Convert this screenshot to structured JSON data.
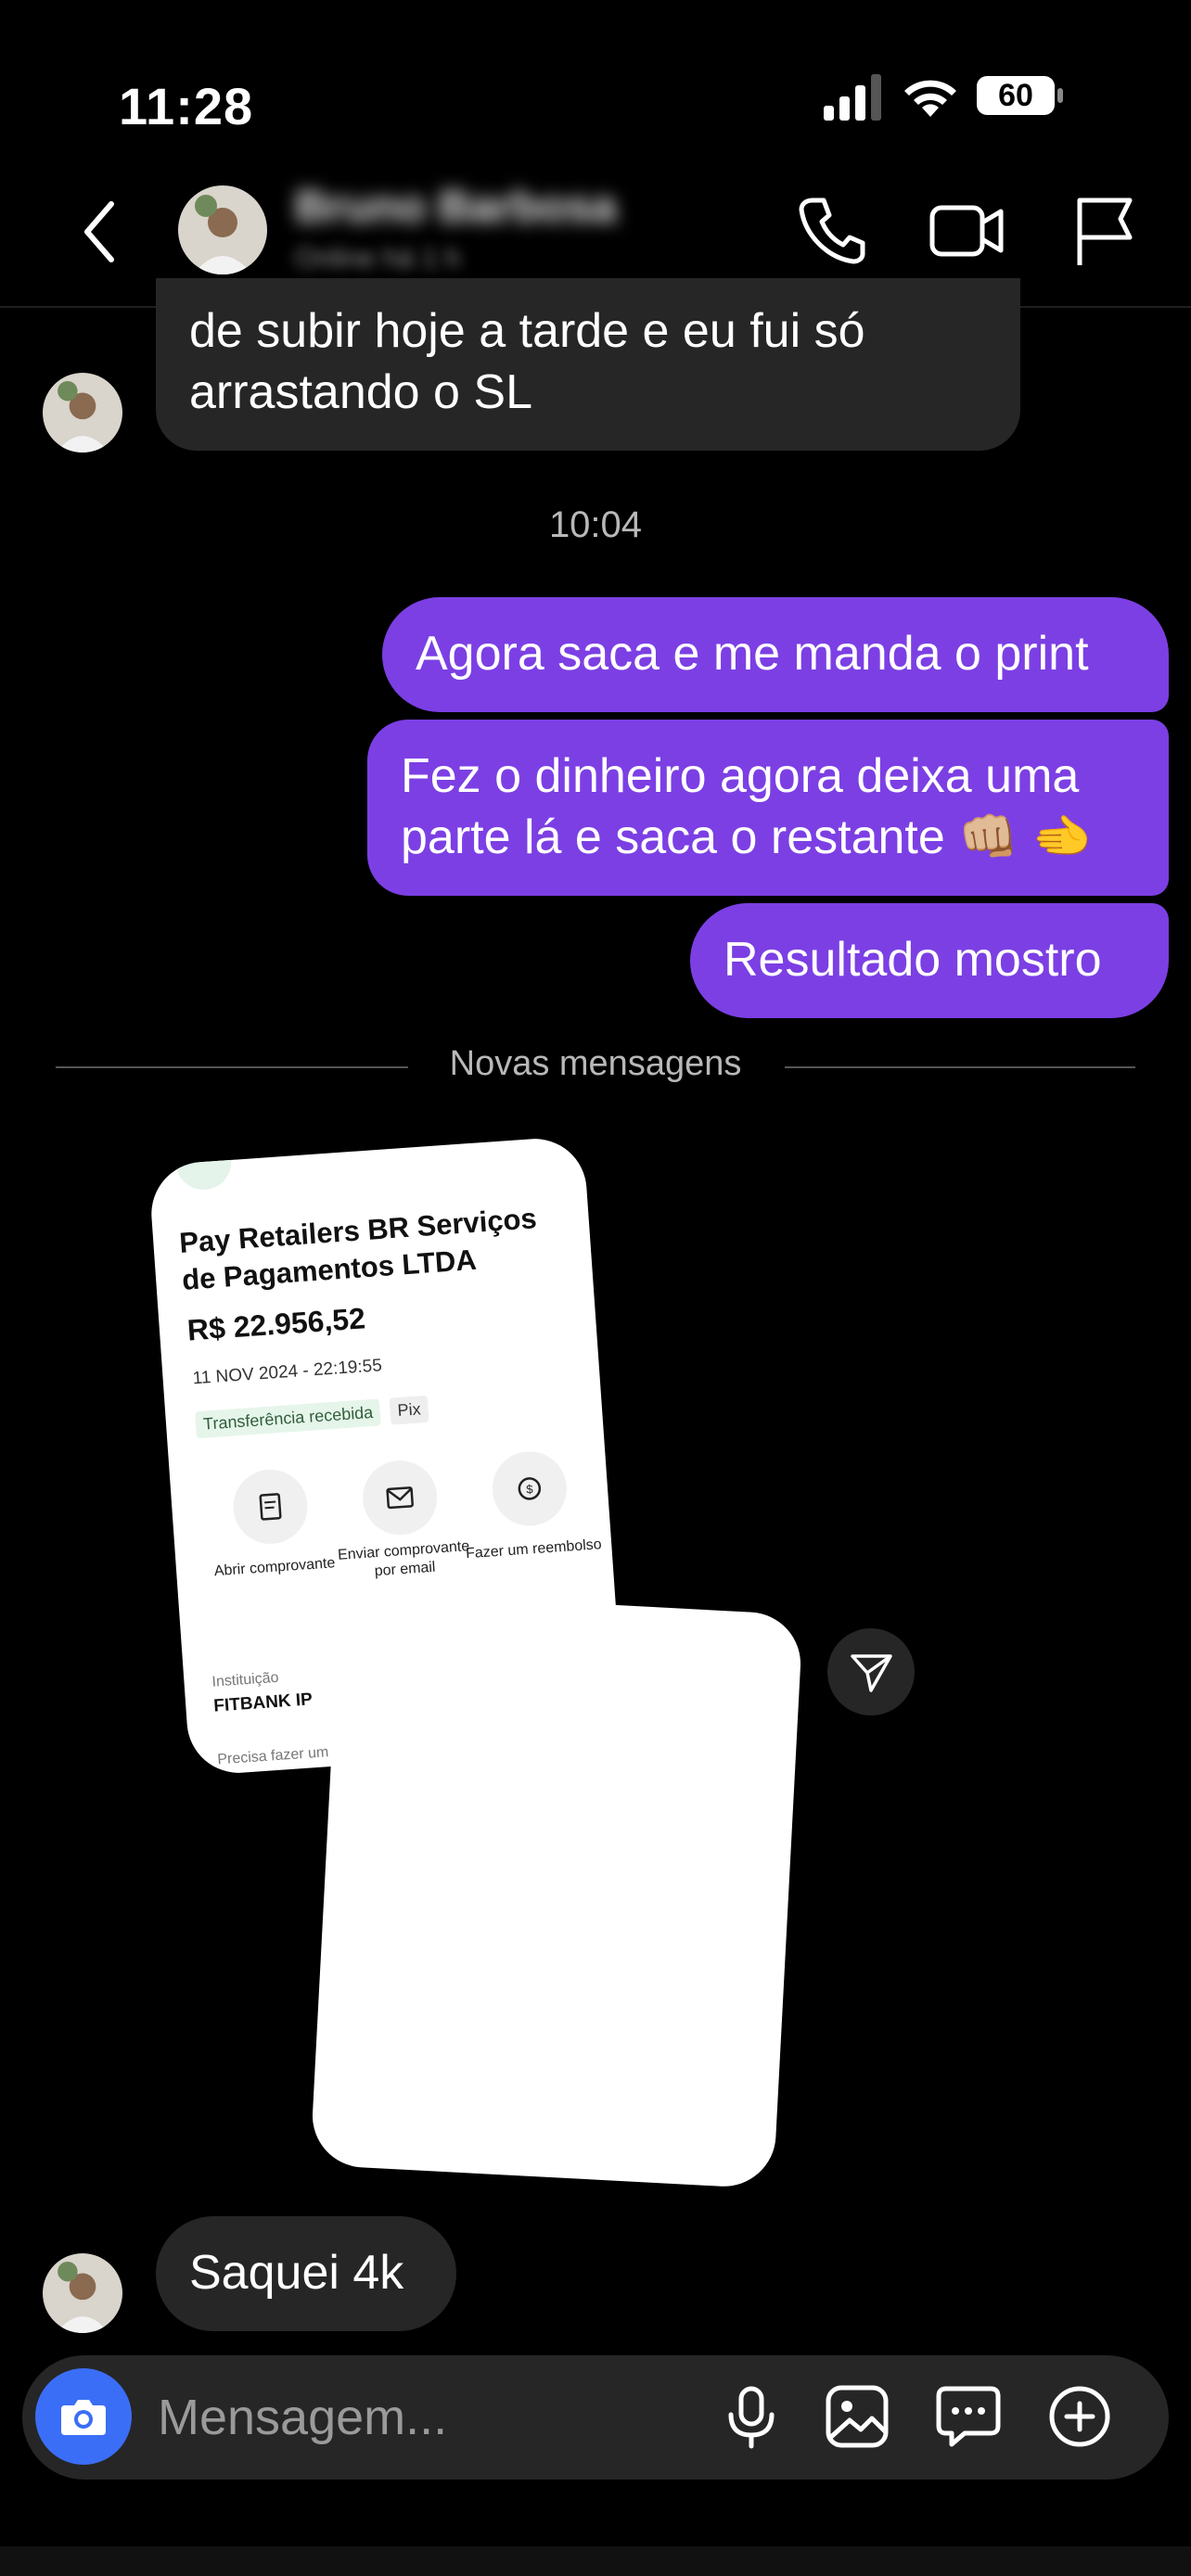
{
  "status_bar": {
    "time": "11:28",
    "battery": "60"
  },
  "header": {
    "contact_name": "Bruno Barbosa",
    "contact_status": "Online há 1 h",
    "icons": [
      "back-icon",
      "phone-icon",
      "video-camera-icon",
      "flag-icon"
    ]
  },
  "messages": {
    "incoming_1": "de subir hoje a tarde e eu fui só arrastando o SL",
    "timestamp": "10:04",
    "outgoing_1": "Agora saca e me manda o print",
    "outgoing_2_line1": "Fez o dinheiro agora deixa uma",
    "outgoing_2_line2": "parte lá e saca o restante 👊🏼 🫲",
    "outgoing_3": "Resultado mostro",
    "new_messages_label": "Novas mensagens",
    "incoming_2": "Saquei 4k"
  },
  "receipt": {
    "merchant": "Pay Retailers BR Serviços de Pagamentos LTDA",
    "amount": "R$ 22.956,52",
    "datetime": "11 NOV 2024 - 22:19:55",
    "tag_type": "Transferência recebida",
    "tag_method": "Pix",
    "action_1": "Abrir comprovante",
    "action_2": "Enviar comprovante por email",
    "action_3": "Fazer um reembolso",
    "institution_label": "Instituição",
    "institution_value": "FITBANK IP",
    "help_text": "Precisa fazer um re"
  },
  "composer": {
    "placeholder": "Mensagem...",
    "icons": [
      "camera-icon",
      "microphone-icon",
      "gallery-icon",
      "sticker-icon",
      "plus-icon"
    ]
  },
  "colors": {
    "outgoing_bubble": "#7c3fe4",
    "incoming_bubble": "#262626",
    "camera_button": "#3b6ef6",
    "background": "#000000"
  }
}
